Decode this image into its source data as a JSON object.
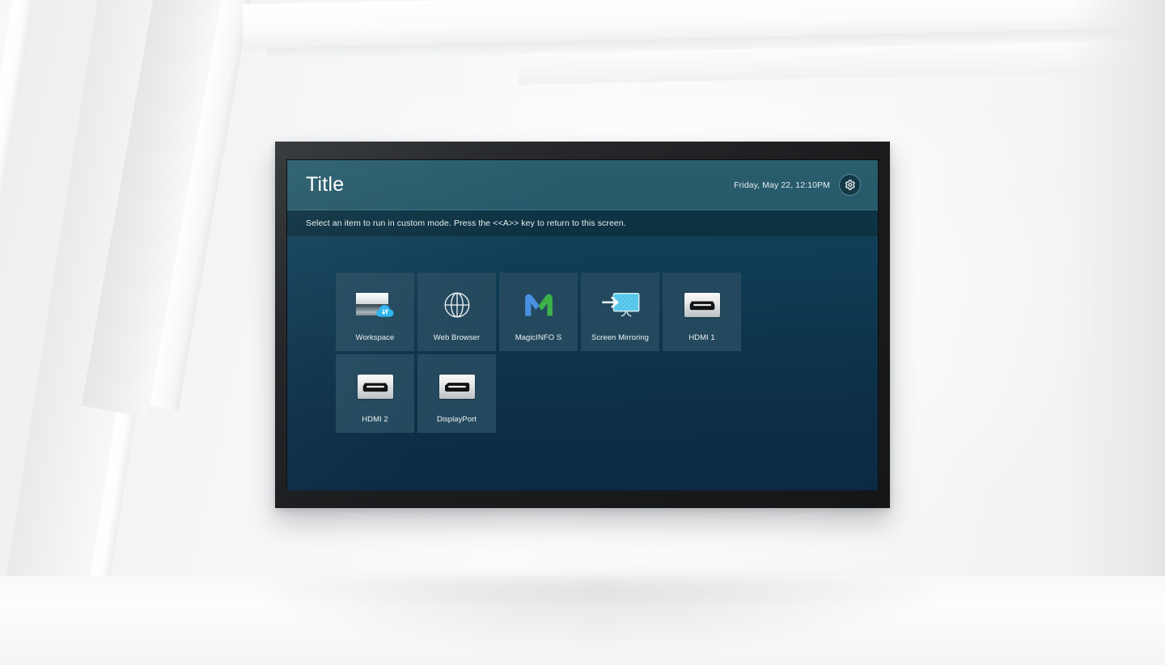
{
  "device": {
    "type": "wall-mounted-display",
    "bezel_color": "#1a1c1e"
  },
  "screen": {
    "header": {
      "title": "Title",
      "clock": "Friday, May 22, 12:10PM",
      "settings_icon": "gear-icon",
      "background_color": "#2a5e6c"
    },
    "notice": {
      "text": "Select an item to run in custom mode. Press the <<A>> key to return to this screen.",
      "background_color": "#0e3443"
    },
    "background_gradient": {
      "top": "#12475c",
      "bottom": "#0c2944"
    },
    "tile_color": "#24495e",
    "rows": [
      {
        "tiles": [
          {
            "label": "Workspace",
            "icon": "workspace-cloud-icon"
          },
          {
            "label": "Web Browser",
            "icon": "globe-icon"
          },
          {
            "label": "MagicINFO S",
            "icon": "magicinfo-logo-icon"
          },
          {
            "label": "Screen Mirroring",
            "icon": "screen-mirroring-icon"
          },
          {
            "label": "HDMI 1",
            "icon": "hdmi-port-icon"
          }
        ]
      },
      {
        "tiles": [
          {
            "label": "HDMI 2",
            "icon": "hdmi-port-icon"
          },
          {
            "label": "DisplayPort",
            "icon": "displayport-icon"
          }
        ]
      }
    ],
    "accent_colors": {
      "teal_header": "#2a5e6c",
      "cloud_blue": "#2eb4ef",
      "magicinfo_blue": "#4a90e2",
      "magicinfo_green": "#4caf50",
      "mirroring_cyan": "#4fc3e8"
    }
  },
  "room": {
    "wall_color": "#f4f5f6",
    "floor_color": "#fafafa"
  }
}
